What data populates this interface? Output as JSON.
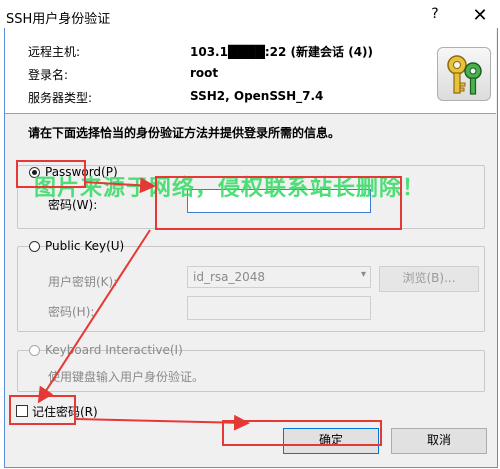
{
  "window": {
    "title": "SSH用户身份验证",
    "help": "?",
    "close": "✕"
  },
  "info": {
    "remote_host_label": "远程主机:",
    "remote_host_value": "103.1████:22 (新建会话 (4))",
    "login_label": "登录名:",
    "login_value": "root",
    "server_type_label": "服务器类型:",
    "server_type_value": "SSH2, OpenSSH_7.4"
  },
  "instruction": "请在下面选择恰当的身份验证方法并提供登录所需的信息。",
  "watermark": "图片来源于网络，侵权联系站长删除！",
  "methods": {
    "password": {
      "label": "Password(P)",
      "field_label": "密码(W):",
      "value": "",
      "selected": true
    },
    "public_key": {
      "label": "Public Key(U)",
      "user_key_label": "用户密钥(K):",
      "user_key_value": "id_rsa_2048",
      "browse_label": "浏览(B)...",
      "passphrase_label": "密码(H):",
      "selected": false
    },
    "keyboard_interactive": {
      "label": "Keyboard Interactive(I)",
      "description": "使用键盘输入用户身份验证。",
      "selected": false
    }
  },
  "remember_password": {
    "label": "记住密码(R)",
    "checked": false
  },
  "buttons": {
    "ok": "确定",
    "cancel": "取消"
  },
  "icons": {
    "key": "key-icon",
    "dropdown": "chevron-down-icon"
  },
  "colors": {
    "annotation": "#e53935",
    "watermark": "#3ddc6b",
    "focus": "#3c7fd1"
  }
}
